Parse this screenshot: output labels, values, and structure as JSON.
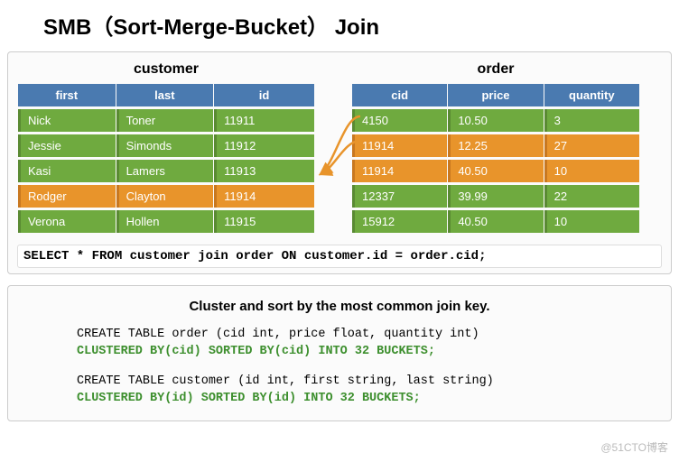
{
  "title": "SMB（Sort-Merge-Bucket） Join",
  "customer": {
    "name": "customer",
    "headers": [
      "first",
      "last",
      "id"
    ],
    "rows": [
      {
        "first": "Nick",
        "last": "Toner",
        "id": "11911",
        "hl": false
      },
      {
        "first": "Jessie",
        "last": "Simonds",
        "id": "11912",
        "hl": false
      },
      {
        "first": "Kasi",
        "last": "Lamers",
        "id": "11913",
        "hl": false
      },
      {
        "first": "Rodger",
        "last": "Clayton",
        "id": "11914",
        "hl": true
      },
      {
        "first": "Verona",
        "last": "Hollen",
        "id": "11915",
        "hl": false
      }
    ]
  },
  "order": {
    "name": "order",
    "headers": [
      "cid",
      "price",
      "quantity"
    ],
    "rows": [
      {
        "cid": "4150",
        "price": "10.50",
        "quantity": "3",
        "hl": false
      },
      {
        "cid": "11914",
        "price": "12.25",
        "quantity": "27",
        "hl": true
      },
      {
        "cid": "11914",
        "price": "40.50",
        "quantity": "10",
        "hl": true
      },
      {
        "cid": "12337",
        "price": "39.99",
        "quantity": "22",
        "hl": false
      },
      {
        "cid": "15912",
        "price": "40.50",
        "quantity": "10",
        "hl": false
      }
    ]
  },
  "sql": "SELECT * FROM customer join order ON customer.id = order.cid;",
  "cluster_title": "Cluster and sort by the most common join key.",
  "ddl1_line1": "CREATE TABLE order (cid int, price float, quantity int)",
  "ddl1_line2": "CLUSTERED BY(cid) SORTED BY(cid) INTO 32 BUCKETS;",
  "ddl2_line1": "CREATE TABLE customer (id int, first string, last string)",
  "ddl2_line2": "CLUSTERED BY(id) SORTED BY(id) INTO 32 BUCKETS;",
  "watermark": "@51CTO博客"
}
